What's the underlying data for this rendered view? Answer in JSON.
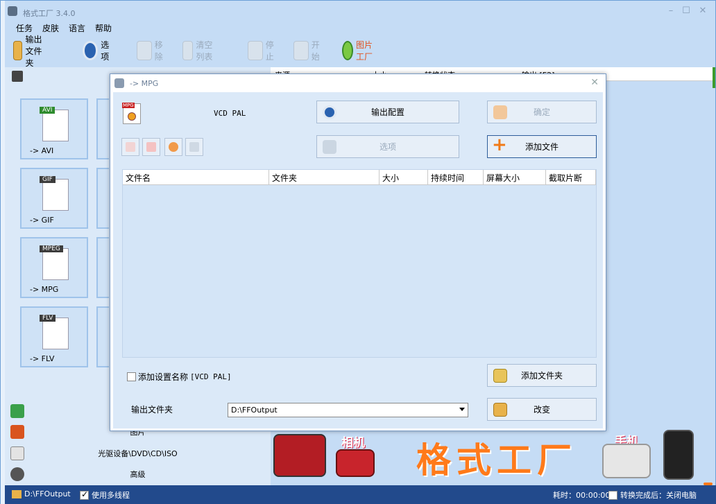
{
  "window": {
    "title": "格式工厂 3.4.0",
    "min": "–",
    "max": "☐",
    "close": "✕"
  },
  "menu": [
    "任务",
    "皮肤",
    "语言",
    "帮助"
  ],
  "toolbar": {
    "output_folder": "输出文件夹",
    "options": "选项",
    "remove": "移除",
    "clear_list": "清空列表",
    "stop": "停止",
    "start": "开始",
    "image_factory": "图片工厂"
  },
  "left_panel": {
    "tiles": [
      "-> AVI",
      "-> GIF",
      "-> MPG",
      "-> FLV"
    ],
    "badges": [
      "AVI",
      "GIF",
      "MPEG",
      "FLV"
    ],
    "categories": [
      "图片",
      "光驱设备\\DVD\\CD\\ISO",
      "高级"
    ]
  },
  "task_table": {
    "columns": [
      "来源",
      "大小",
      "转换状态",
      "输出 [F2]"
    ]
  },
  "banner": {
    "brand": "格式工厂",
    "camera_tag": "相机",
    "phone_tag": "手机"
  },
  "status_bar": {
    "output_path": "D:\\FFOutput",
    "multithread": "使用多线程",
    "elapsed": "耗时：00:00:00",
    "after_done": "转换完成后：关闭电脑"
  },
  "dialog": {
    "title": "-> MPG",
    "preset": "VCD PAL",
    "output_config": "输出配置",
    "ok": "确定",
    "options": "选项",
    "add_file": "添加文件",
    "columns": [
      "文件名",
      "文件夹",
      "大小",
      "持续时间",
      "屏幕大小",
      "截取片断"
    ],
    "add_setting_name_label": "添加设置名称",
    "add_setting_name_value": "[VCD PAL]",
    "add_folder": "添加文件夹",
    "output_folder_label": "输出文件夹",
    "output_folder_value": "D:\\FFOutput",
    "change": "改变"
  },
  "colors": {
    "window_bg": "#c5dcf5",
    "status_bar": "#224a8c",
    "brand_orange": "#ff7a1a",
    "disabled_text": "#9aaabc"
  }
}
